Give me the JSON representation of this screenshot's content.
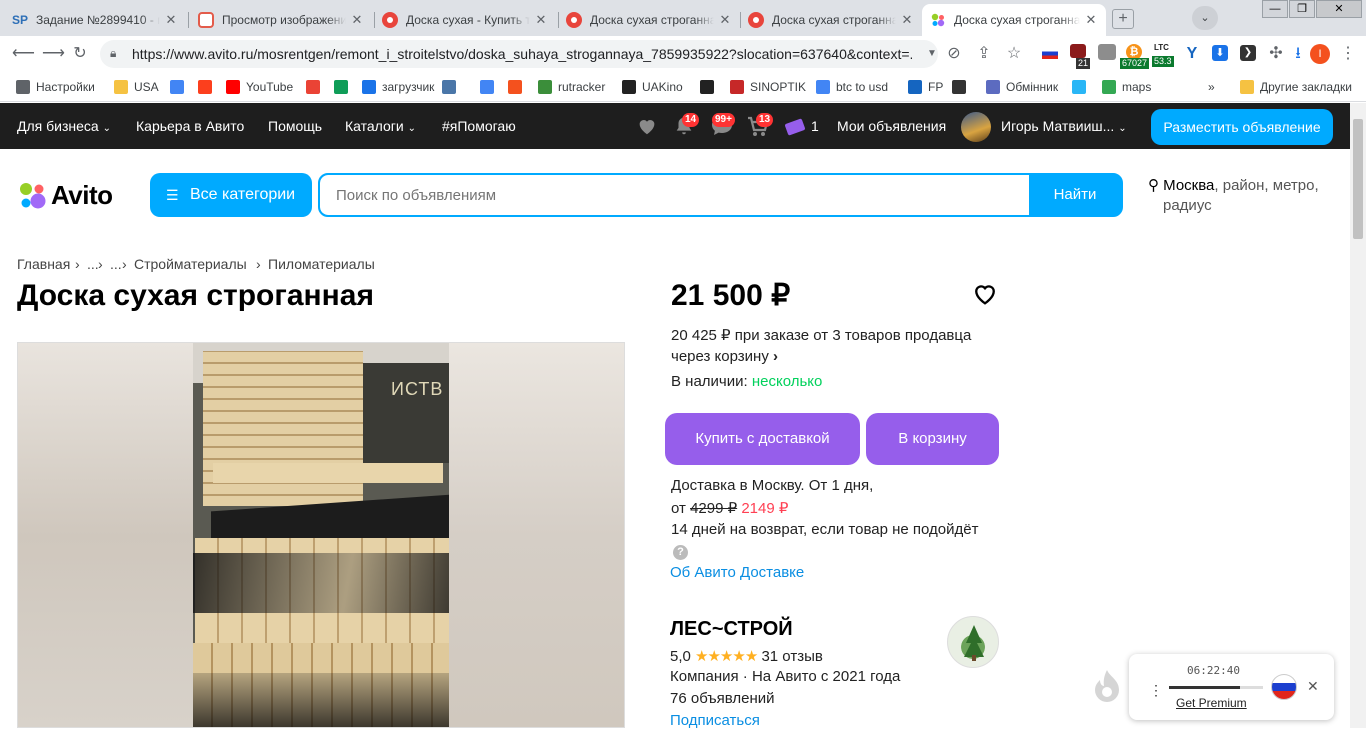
{
  "browser": {
    "tabs": [
      {
        "title": "Задание №2899410 - п",
        "favicon_text": "SP",
        "favicon_color": "#2d6fb7"
      },
      {
        "title": "Просмотр изображени",
        "favicon_text": "◌",
        "favicon_color": "#e35b4a"
      },
      {
        "title": "Доска сухая - Купить то",
        "favicon_text": "",
        "favicon_color": "#e8453c"
      },
      {
        "title": "Доска сухая строганная",
        "favicon_text": "",
        "favicon_color": "#e8453c"
      },
      {
        "title": "Доска сухая строганная",
        "favicon_text": "",
        "favicon_color": "#e8453c"
      },
      {
        "title": "Доска сухая строганная",
        "favicon_text": "",
        "favicon_color": "#97cf26"
      }
    ],
    "url": "https://www.avito.ru/mosrentgen/remont_i_stroitelstvo/doska_suhaya_strogannaya_7859935922?slocation=637640&context=...",
    "ext_badges": {
      "b1": "21",
      "b2": "67027",
      "b3": "53.3",
      "ltc": "LTC"
    },
    "bookmarks": [
      {
        "label": "Настройки",
        "icon": "gear-icon",
        "color": "#5f6368"
      },
      {
        "label": "USA",
        "icon": "folder-icon",
        "color": "#f5c242"
      },
      {
        "label": "",
        "icon": "google-icon",
        "color": "#4285f4"
      },
      {
        "label": "",
        "icon": "yandex-icon",
        "color": "#fc3f1d"
      },
      {
        "label": "YouTube",
        "icon": "youtube-icon",
        "color": "#ff0000"
      },
      {
        "label": "",
        "icon": "gmail-icon",
        "color": "#ea4335"
      },
      {
        "label": "",
        "icon": "drive-icon",
        "color": "#0f9d58"
      },
      {
        "label": "загрузчик",
        "icon": "infinity-icon",
        "color": "#1a73e8"
      },
      {
        "label": "",
        "icon": "vk-icon",
        "color": "#4a76a8"
      },
      {
        "label": "",
        "icon": "translate-icon",
        "color": "#4285f4"
      },
      {
        "label": "",
        "icon": "f-icon",
        "color": "#f4511e"
      },
      {
        "label": "rutracker",
        "icon": "rutracker-icon",
        "color": "#3b8e3a"
      },
      {
        "label": "UAKino",
        "icon": "uakino-icon",
        "color": "#222222"
      },
      {
        "label": "",
        "icon": "chess-icon",
        "color": "#222222"
      },
      {
        "label": "SINOPTIK",
        "icon": "thermometer-icon",
        "color": "#c62828"
      },
      {
        "label": "btc to usd",
        "icon": "google-icon",
        "color": "#4285f4"
      },
      {
        "label": "FP",
        "icon": "fp-icon",
        "color": "#1565c0"
      },
      {
        "label": "",
        "icon": "bc-icon",
        "color": "#333333"
      },
      {
        "label": "Обмінник",
        "icon": "exchange-icon",
        "color": "#5c6bc0"
      },
      {
        "label": "",
        "icon": "star-burst-icon",
        "color": "#29b6f6"
      },
      {
        "label": "maps",
        "icon": "map-pin-icon",
        "color": "#34a853"
      }
    ],
    "more": "»",
    "other_bookmarks": "Другие закладки",
    "window_buttons": {
      "min": "—",
      "max": "❐",
      "close": "✕"
    }
  },
  "avito": {
    "topnav": {
      "for_business": "Для бизнеса",
      "career": "Карьера в Авито",
      "help": "Помощь",
      "catalogs": "Каталоги",
      "ya_help": "#яПомогаю",
      "notif_count": "14",
      "msg_count": "99+",
      "cart_count": "13",
      "bonus_count": "1",
      "my_ads": "Мои объявления",
      "user_name": "Игорь Матвииш...",
      "post_ad": "Разместить объявление"
    },
    "logo_text": "Avito",
    "all_categories": "Все категории",
    "search_placeholder": "Поиск по объявлениям",
    "search_button": "Найти",
    "location_city": "Москва",
    "location_rest": ", район, метро,",
    "location_radius": "радиус"
  },
  "breadcrumbs": [
    "Главная",
    "...",
    "...",
    "Стройматериалы",
    "Пиломатериалы"
  ],
  "breadcrumb_sep": "›",
  "listing": {
    "title": "Доска сухая строганная",
    "price": "21 500 ₽",
    "bulk_line1": "20 425 ₽ при заказе от 3 товаров продавца",
    "bulk_line2": "через корзину",
    "stock_label": "В наличии:",
    "stock_value": "несколько",
    "buy_delivery": "Купить с доставкой",
    "to_cart": "В корзину",
    "delivery_line1": "Доставка в Москву. От 1 дня,",
    "delivery_from": "от",
    "delivery_old_price": "4299 ₽",
    "delivery_new_price": "2149 ₽",
    "return_text": "14 дней на возврат, если товар не подойдёт",
    "about_delivery": "Об Авито Доставке",
    "photo_overlay_text": "ИСТВ"
  },
  "seller": {
    "name": "ЛЕС~СТРОЙ",
    "rating": "5,0",
    "stars": 5,
    "reviews": "31 отзыв",
    "info": "Компания · На Авито с 2021 года",
    "ads": "76 объявлений",
    "subscribe": "Подписаться"
  },
  "vpn_widget": {
    "timer": "06:22:40",
    "premium": "Get Premium",
    "progress": 0.75
  },
  "colors": {
    "accent": "#00aaff",
    "purple": "#965eeb",
    "green": "#02d15c",
    "red": "#ff4053",
    "link": "#0a8ee2",
    "dark": "#1e1e1e"
  }
}
